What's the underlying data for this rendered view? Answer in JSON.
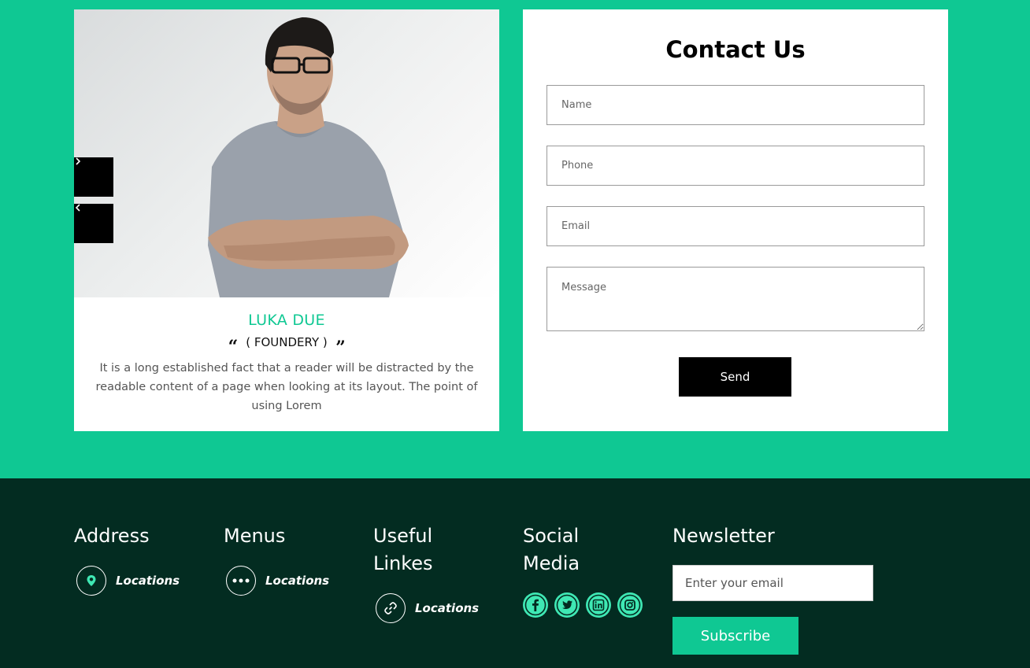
{
  "testimonial": {
    "name": "LUKA DUE",
    "role": "( FOUNDERY )",
    "bio": "It is a long established fact that a reader will be distracted by the readable content of a page when looking at its layout. The point of using Lorem",
    "next_icon": "chevron-right-icon",
    "prev_icon": "chevron-left-icon",
    "accent_color": "#0fc893"
  },
  "contact": {
    "title": "Contact Us",
    "name_placeholder": "Name",
    "phone_placeholder": "Phone",
    "email_placeholder": "Email",
    "message_placeholder": "Message",
    "send_label": "Send"
  },
  "footer": {
    "background": "#032c21",
    "address": {
      "title": "Address",
      "link_label": "Locations",
      "icon": "map-pin-icon"
    },
    "menus": {
      "title": "Menus",
      "link_label": "Locations",
      "icon": "more-dots-icon"
    },
    "useful": {
      "title_line1": "Useful",
      "title_line2": "Linkes",
      "link_label": "Locations",
      "icon": "link-icon"
    },
    "social": {
      "title_line1": "Social",
      "title_line2": "Media",
      "icons": [
        "facebook-icon",
        "twitter-icon",
        "linkedin-icon",
        "instagram-icon"
      ],
      "icon_color": "#3fe8b4"
    },
    "newsletter": {
      "title": "Newsletter",
      "email_placeholder": "Enter your email",
      "subscribe_label": "Subscribe"
    }
  }
}
